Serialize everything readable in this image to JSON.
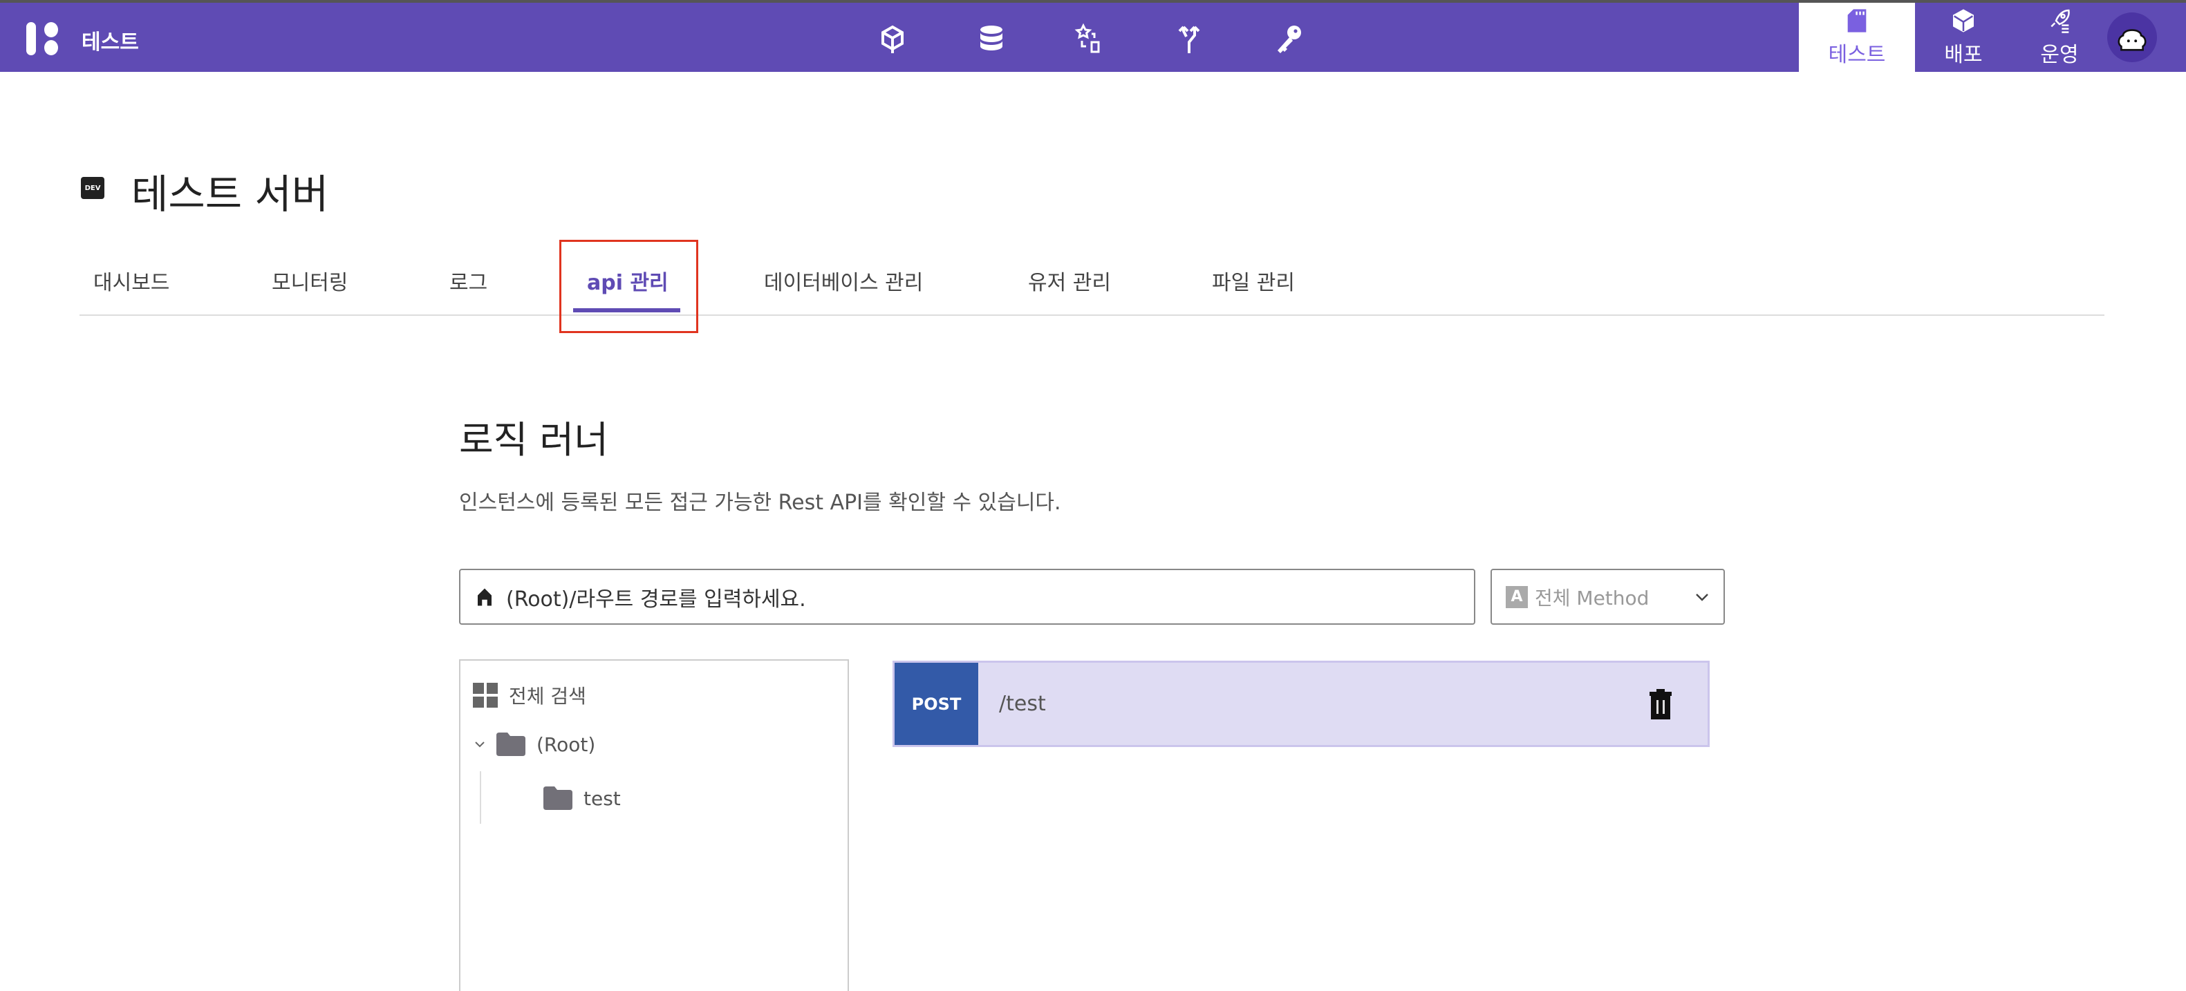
{
  "header": {
    "brand": "테스트",
    "nav_icons": [
      "cube-icon",
      "database-icon",
      "star-transform-icon",
      "fork-icon",
      "key-icon"
    ],
    "right_tabs": [
      {
        "label": "테스트",
        "icon": "sd-card-icon",
        "active": true
      },
      {
        "label": "배포",
        "icon": "box-icon",
        "active": false
      },
      {
        "label": "운영",
        "icon": "rocket-icon",
        "active": false
      }
    ],
    "brand_color": "#5f4bb4"
  },
  "page": {
    "env_badge": "DEV",
    "title": "테스트 서버",
    "tabs": [
      {
        "label": "대시보드"
      },
      {
        "label": "모니터링"
      },
      {
        "label": "로그"
      },
      {
        "label": "api 관리",
        "active": true
      },
      {
        "label": "데이터베이스 관리"
      },
      {
        "label": "유저 관리"
      },
      {
        "label": "파일 관리"
      }
    ]
  },
  "main": {
    "heading": "로직 러너",
    "description": "인스턴스에 등록된 모든 접근 가능한 Rest API를 확인할 수 있습니다.",
    "search": {
      "prefix": "(Root)/",
      "placeholder": "라우트 경로를 입력하세요."
    },
    "method_select": {
      "badge": "A",
      "value": "전체 Method"
    },
    "tree": {
      "search_all": "전체 검색",
      "root": "(Root)",
      "children": [
        "test"
      ]
    },
    "routes": [
      {
        "method": "POST",
        "path": "/test",
        "method_color": "#335aa8"
      }
    ]
  }
}
